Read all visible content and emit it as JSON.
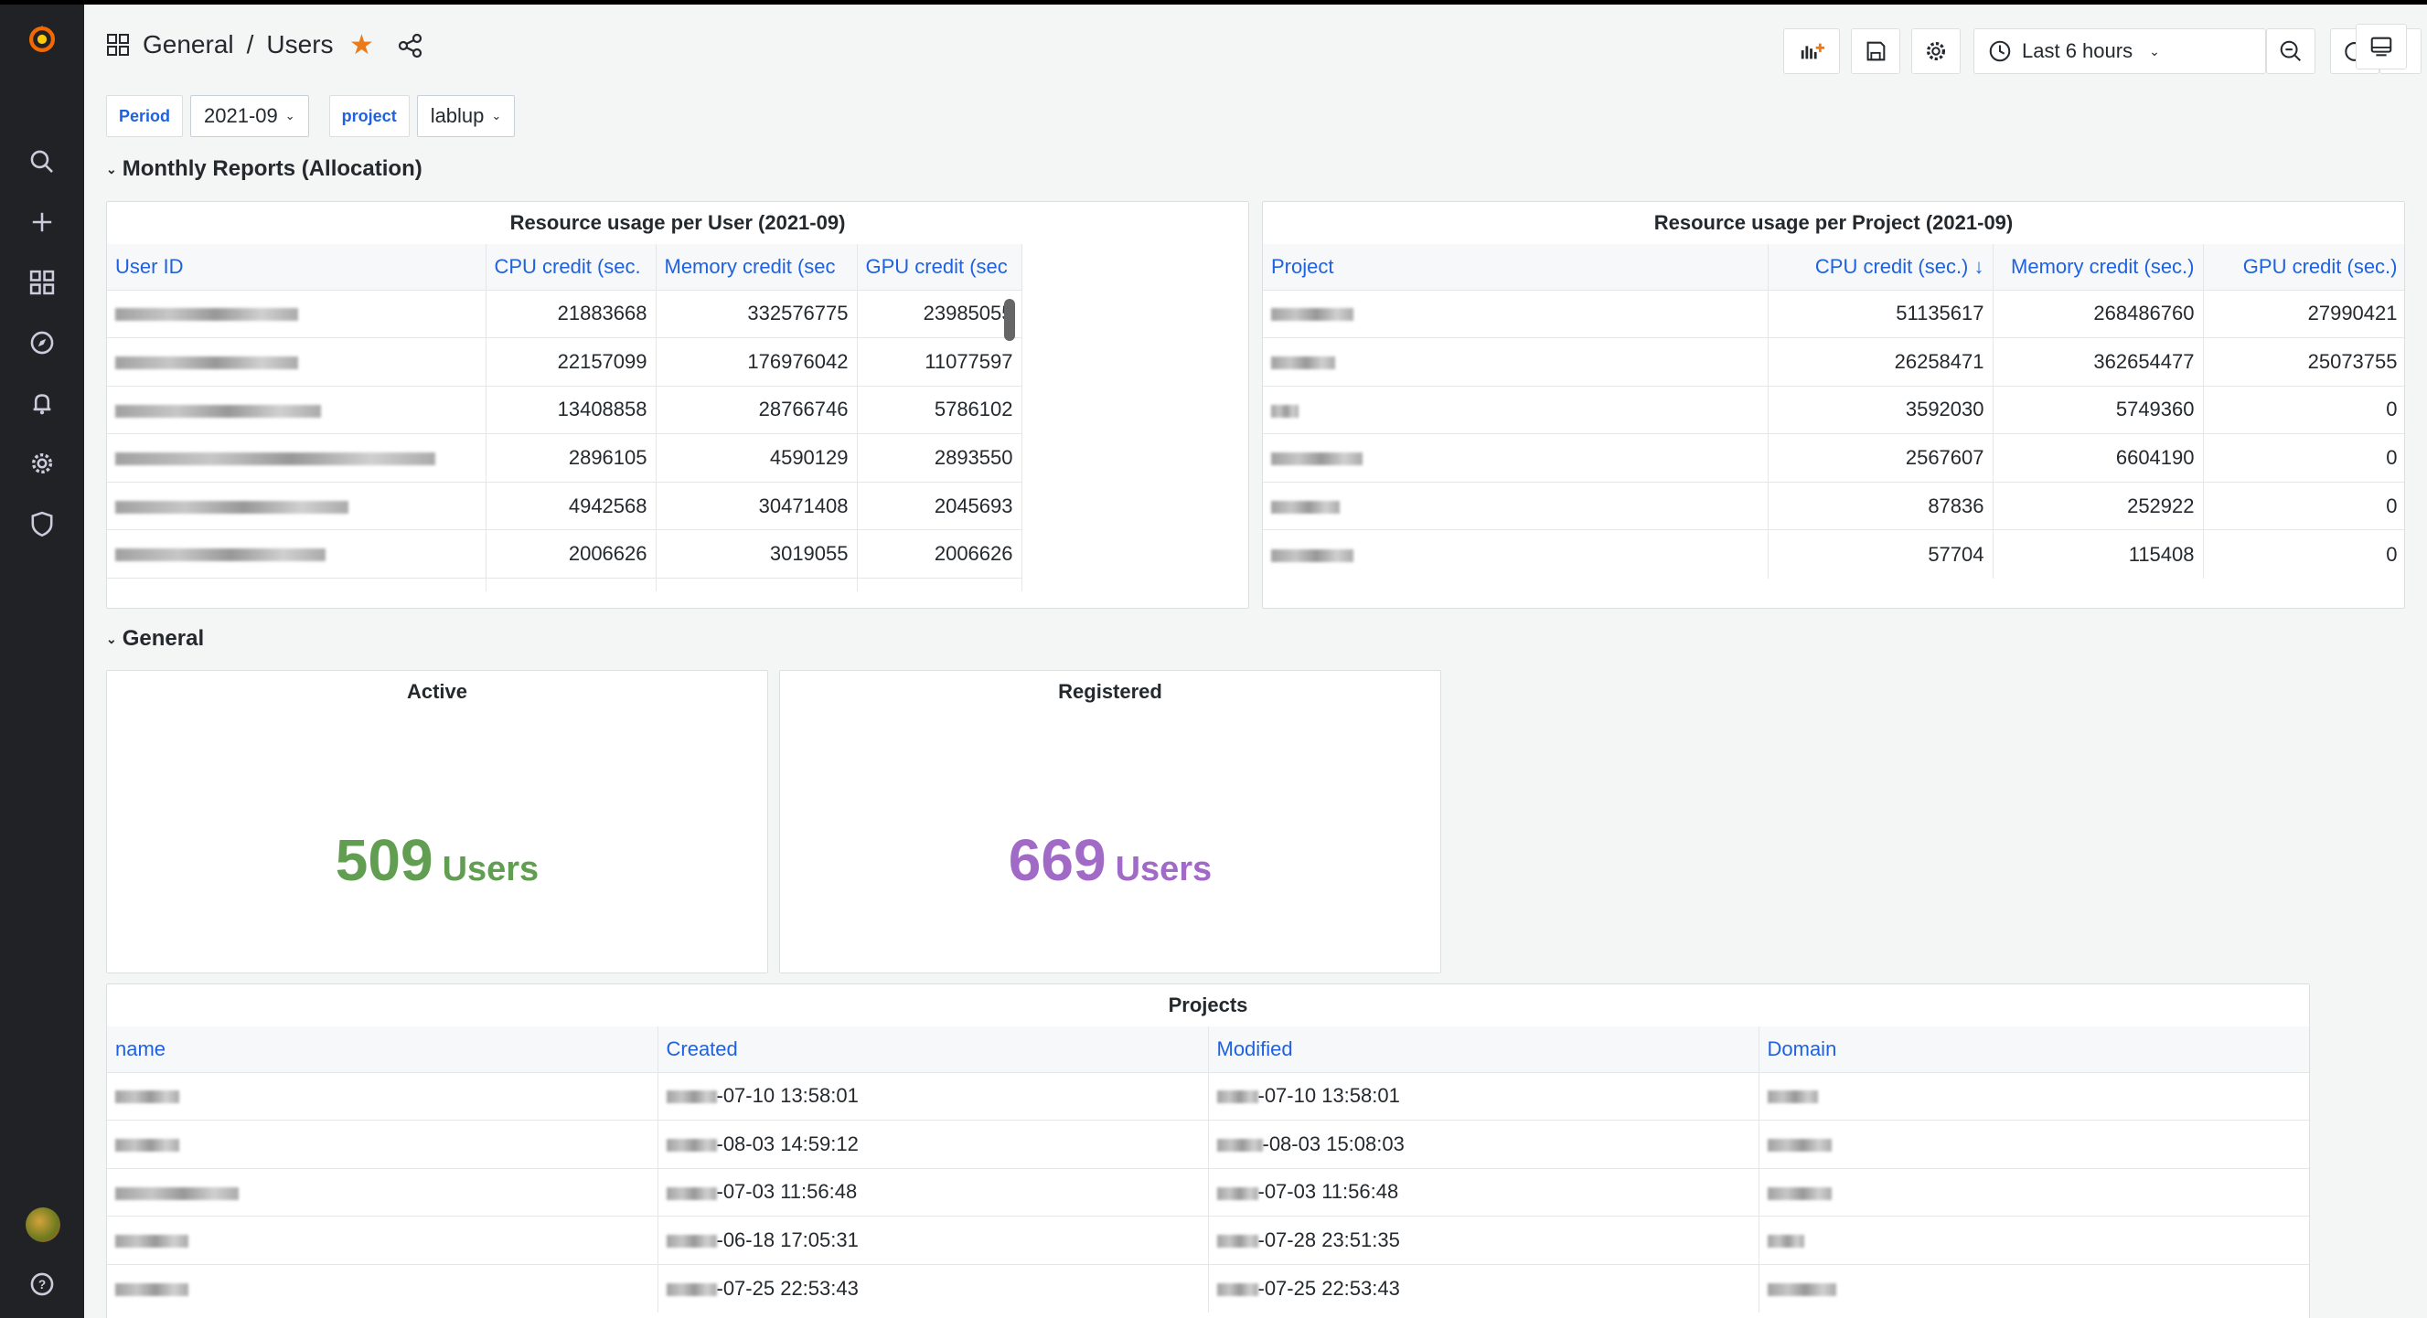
{
  "header": {
    "breadcrumb_folder": "General",
    "breadcrumb_sep": "/",
    "breadcrumb_title": "Users",
    "time_range": "Last 6 hours"
  },
  "variables": [
    {
      "label": "Period",
      "value": "2021-09"
    },
    {
      "label": "project",
      "value": "lablup"
    }
  ],
  "rows": {
    "monthly": "Monthly Reports (Allocation)",
    "general": "General"
  },
  "user_table": {
    "title": "Resource usage per User (2021-09)",
    "columns": [
      "User ID",
      "CPU credit (sec.",
      "Memory credit (sec",
      "GPU credit (sec"
    ],
    "rows": [
      {
        "cpu": "21883668",
        "mem": "332576775",
        "gpu": "23985055"
      },
      {
        "cpu": "22157099",
        "mem": "176976042",
        "gpu": "11077597"
      },
      {
        "cpu": "13408858",
        "mem": "28766746",
        "gpu": "5786102"
      },
      {
        "cpu": "2896105",
        "mem": "4590129",
        "gpu": "2893550"
      },
      {
        "cpu": "4942568",
        "mem": "30471408",
        "gpu": "2045693"
      },
      {
        "cpu": "2006626",
        "mem": "3019055",
        "gpu": "2006626"
      }
    ]
  },
  "project_table": {
    "title": "Resource usage per Project (2021-09)",
    "columns": [
      "Project",
      "CPU credit (sec.) ↓",
      "Memory credit (sec.)",
      "GPU credit (sec.)"
    ],
    "rows": [
      {
        "cpu": "51135617",
        "mem": "268486760",
        "gpu": "27990421"
      },
      {
        "cpu": "26258471",
        "mem": "362654477",
        "gpu": "25073755"
      },
      {
        "cpu": "3592030",
        "mem": "5749360",
        "gpu": "0"
      },
      {
        "cpu": "2567607",
        "mem": "6604190",
        "gpu": "0"
      },
      {
        "cpu": "87836",
        "mem": "252922",
        "gpu": "0"
      },
      {
        "cpu": "57704",
        "mem": "115408",
        "gpu": "0"
      }
    ]
  },
  "stats": {
    "active": {
      "title": "Active",
      "value": "509",
      "unit": "Users",
      "color": "#629e51"
    },
    "registered": {
      "title": "Registered",
      "value": "669",
      "unit": "Users",
      "color": "#a16ac7"
    }
  },
  "projects_table": {
    "title": "Projects",
    "columns": [
      "name",
      "Created",
      "Modified",
      "Domain"
    ],
    "rows": [
      {
        "created": "-07-10 13:58:01",
        "modified": "-07-10 13:58:01"
      },
      {
        "created": "-08-03 14:59:12",
        "modified": "-08-03 15:08:03"
      },
      {
        "created": "-07-03 11:56:48",
        "modified": "-07-03 11:56:48"
      },
      {
        "created": "-06-18 17:05:31",
        "modified": "-07-28 23:51:35"
      },
      {
        "created": "-07-25 22:53:43",
        "modified": "-07-25 22:53:43"
      }
    ]
  },
  "colors": {
    "accent": "#1f62e0",
    "sidebar": "#202226",
    "star": "#eb7b18"
  }
}
